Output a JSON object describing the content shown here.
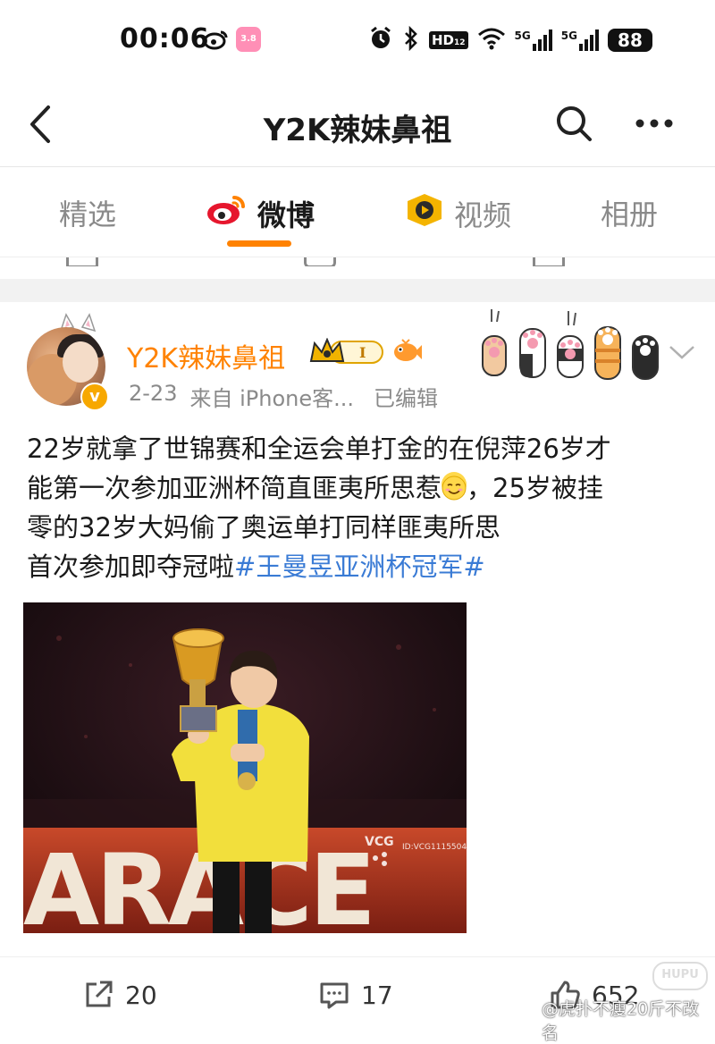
{
  "status_bar": {
    "time": "00:06",
    "app_icon_text": "3.8",
    "hd_label": "HD",
    "hd_sub": "12",
    "signal1_label": "5G",
    "signal2_label": "5G",
    "battery": "88"
  },
  "nav": {
    "title": "Y2K辣妹鼻祖"
  },
  "tabs": [
    {
      "label": "精选"
    },
    {
      "label": "微博"
    },
    {
      "label": "视频"
    },
    {
      "label": "相册"
    }
  ],
  "post": {
    "author": "Y2K辣妹鼻祖",
    "level_badge": "I",
    "date": "2-23",
    "source": "来自 iPhone客...",
    "edited": "已编辑",
    "text_lines": [
      "22岁就拿了世锦赛和全运会单打金的在倪萍26岁才",
      "能第一次参加亚洲杯简直匪夷所思惹",
      "，25岁被挂",
      "零的32岁大妈偷了奥运单打同样匪夷所思",
      "首次参加即夺冠啦"
    ],
    "hashtag": "#王曼昱亚洲杯冠军#",
    "photo_watermark": "VCG",
    "photo_watermark_id": "ID:VCG11155045",
    "photo_banner_text": "ARACE"
  },
  "actions": {
    "repost_count": "20",
    "comment_count": "17",
    "like_count": "652"
  },
  "watermark": {
    "text": "@虎扑不瘦20斤不改名",
    "logo": "HUPU"
  },
  "colors": {
    "accent_orange": "#ff8200",
    "hashtag_blue": "#3a7bd5",
    "name_orange": "#ff8200"
  }
}
